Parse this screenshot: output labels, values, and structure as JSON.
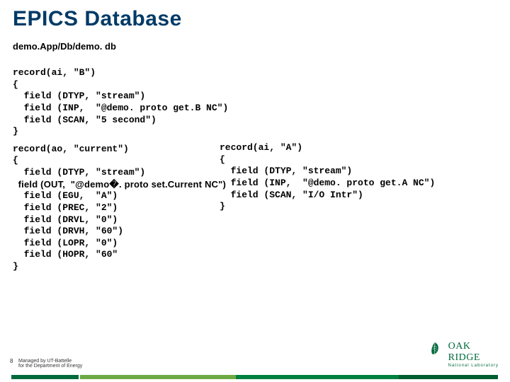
{
  "title": "EPICS Database",
  "subtitle": "demo.App/Db/demo. db",
  "code": {
    "block1": "record(ai, \"B\")\n{\n  field (DTYP, \"stream\")\n  field (INP,  \"@demo. proto get.B NC\")\n  field (SCAN, \"5 second\")\n}",
    "block2": "record(ai, \"A\")\n{\n  field (DTYP, \"stream\")\n  field (INP,  \"@demo. proto get.A NC\")\n  field (SCAN, \"I/O Intr\")\n}",
    "block3a": "record(ao, \"current\")\n{\n  field (DTYP, \"stream\")",
    "block3b": "  field (OUT,  \"@demo�. proto set.Current NC\")",
    "block3c": "  field (EGU,  \"A\")\n  field (PREC, \"2\")\n  field (DRVL, \"0\")\n  field (DRVH, \"60\")\n  field (LOPR, \"0\")\n  field (HOPR, \"60\"\n}"
  },
  "footer": {
    "page": "8",
    "managed_line1": "Managed by UT-Battelle",
    "managed_line2": "for the Department of Energy",
    "logo_name": "OAK",
    "logo_name2": "RIDGE",
    "logo_sub": "National Laboratory"
  }
}
